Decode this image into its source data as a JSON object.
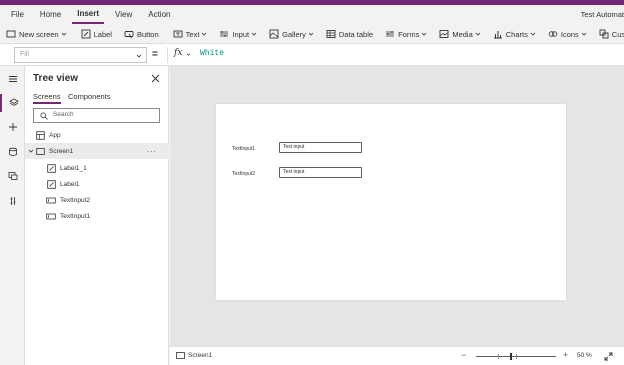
{
  "colors": {
    "brand": "#742774",
    "canvas_bg": "#e5e5e5",
    "formula_value": "#0b8a7a"
  },
  "menu": {
    "items": [
      {
        "label": "File"
      },
      {
        "label": "Home"
      },
      {
        "label": "Insert",
        "active": true
      },
      {
        "label": "View"
      },
      {
        "label": "Action"
      }
    ],
    "app_title": "Test Automat"
  },
  "ribbon": {
    "items": [
      {
        "label": "New screen",
        "icon": "new-screen-icon",
        "dropdown": true
      },
      {
        "label": "Label",
        "icon": "label-icon"
      },
      {
        "label": "Button",
        "icon": "button-icon"
      },
      {
        "label": "Text",
        "icon": "text-icon",
        "dropdown": true
      },
      {
        "label": "Input",
        "icon": "input-icon",
        "dropdown": true
      },
      {
        "label": "Gallery",
        "icon": "gallery-icon",
        "dropdown": true
      },
      {
        "label": "Data table",
        "icon": "data-table-icon"
      },
      {
        "label": "Forms",
        "icon": "forms-icon",
        "dropdown": true
      },
      {
        "label": "Media",
        "icon": "media-icon",
        "dropdown": true
      },
      {
        "label": "Charts",
        "icon": "charts-icon",
        "dropdown": true
      },
      {
        "label": "Icons",
        "icon": "icons-icon",
        "dropdown": true
      },
      {
        "label": "Custom",
        "icon": "custom-icon"
      }
    ]
  },
  "formula": {
    "property_placeholder": "Fill",
    "equals": "=",
    "fx": "fx",
    "value": "White"
  },
  "tree": {
    "title": "Tree view",
    "tabs": [
      {
        "label": "Screens",
        "active": true
      },
      {
        "label": "Components"
      }
    ],
    "search_placeholder": "Search",
    "nodes": [
      {
        "label": "App",
        "icon": "app-icon"
      },
      {
        "label": "Screen1",
        "icon": "screen-icon",
        "selected": true,
        "more": "..."
      },
      {
        "label": "Label1_1",
        "icon": "label-edit-icon"
      },
      {
        "label": "Label1",
        "icon": "label-edit-icon"
      },
      {
        "label": "TextInput2",
        "icon": "text-input-icon"
      },
      {
        "label": "TextInput1",
        "icon": "text-input-icon"
      }
    ]
  },
  "canvas": {
    "fields": [
      {
        "label": "TextInput1",
        "value": "Text input"
      },
      {
        "label": "TextInput2",
        "value": "Text input"
      }
    ]
  },
  "status": {
    "screen_name": "Screen1",
    "zoom_minus": "−",
    "zoom_plus": "+",
    "zoom_level": "50 %",
    "zoom_fraction": 0.44
  }
}
